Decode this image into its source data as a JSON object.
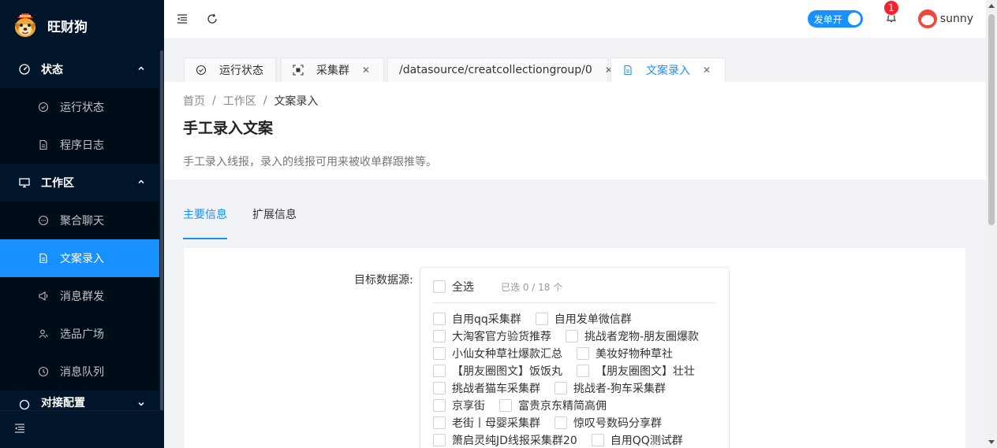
{
  "app": {
    "title": "旺财狗"
  },
  "sidebar": {
    "groups": [
      {
        "label": "状态",
        "icon": "dashboard-icon",
        "items": [
          {
            "label": "运行状态",
            "icon": "check-circle-icon"
          },
          {
            "label": "程序日志",
            "icon": "file-icon"
          }
        ]
      },
      {
        "label": "工作区",
        "icon": "desktop-icon",
        "items": [
          {
            "label": "聚合聊天",
            "icon": "message-icon"
          },
          {
            "label": "文案录入",
            "icon": "file-text-icon",
            "active": true
          },
          {
            "label": "消息群发",
            "icon": "sound-icon"
          },
          {
            "label": "选品广场",
            "icon": "team-icon"
          },
          {
            "label": "消息队列",
            "icon": "clock-icon"
          }
        ]
      },
      {
        "label": "对接配置",
        "icon": "api-icon",
        "items": []
      }
    ]
  },
  "header": {
    "toggle_label": "发单开",
    "notification_count": "1",
    "username": "sunny"
  },
  "tabs": [
    {
      "label": "运行状态",
      "icon": "check-circle-icon",
      "closable": false
    },
    {
      "label": "采集群",
      "icon": "scan-icon",
      "closable": true
    },
    {
      "label": "/datasource/creatcollectiongroup/0",
      "icon": "",
      "closable": true
    },
    {
      "label": "文案录入",
      "icon": "file-text-icon",
      "closable": true,
      "active": true
    }
  ],
  "breadcrumb": [
    "首页",
    "工作区",
    "文案录入"
  ],
  "page": {
    "title": "手工录入文案",
    "description": "手工录入线报，录入的线报可用来被收单群跟推等。"
  },
  "content_tabs": [
    {
      "label": "主要信息",
      "active": true
    },
    {
      "label": "扩展信息",
      "active": false
    }
  ],
  "form": {
    "label": "目标数据源:",
    "select_all": "全选",
    "selected_count": "已选 0 / 18 个",
    "options": [
      [
        "自用qq采集群",
        "自用发单微信群"
      ],
      [
        "大淘客官方验货推荐",
        "挑战者宠物-朋友圈爆款"
      ],
      [
        "小仙女种草社爆款汇总",
        "美妆好物种草社"
      ],
      [
        "【朋友圈图文】饭饭丸",
        "【朋友圈图文】壮壮"
      ],
      [
        "挑战者猫车采集群",
        "挑战者-狗车采集群"
      ],
      [
        "京享街",
        "富贵京东精简高佣"
      ],
      [
        "老街丨母婴采集群",
        "惊叹号数码分享群"
      ],
      [
        "箫启灵纯JD线报采集群20",
        "自用QQ测试群"
      ]
    ]
  },
  "colors": {
    "primary": "#1890ff",
    "sidebar": "#001529",
    "badge": "#f5222d"
  }
}
